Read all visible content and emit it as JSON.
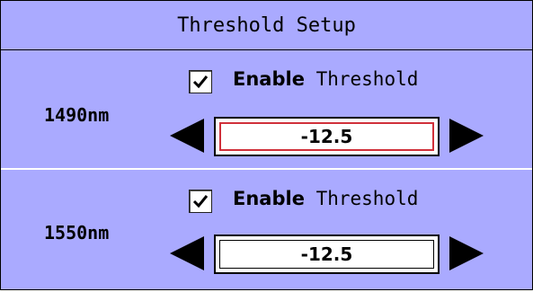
{
  "dialog": {
    "title": "Threshold Setup"
  },
  "wavelengths": [
    {
      "label": "1490nm",
      "enable_checked": true,
      "enable_bold": "Enable",
      "enable_rest": " Threshold",
      "value": "-12.5",
      "focused": true
    },
    {
      "label": "1550nm",
      "enable_checked": true,
      "enable_bold": "Enable",
      "enable_rest": " Threshold",
      "value": "-12.5",
      "focused": false
    }
  ],
  "icons": {
    "checkbox_mark": "check-icon",
    "decrement": "left-arrow-icon",
    "increment": "right-arrow-icon"
  },
  "colors": {
    "panel_background": "#aaaaff",
    "focus_border": "#d0303a",
    "field_background": "#ffffff"
  }
}
